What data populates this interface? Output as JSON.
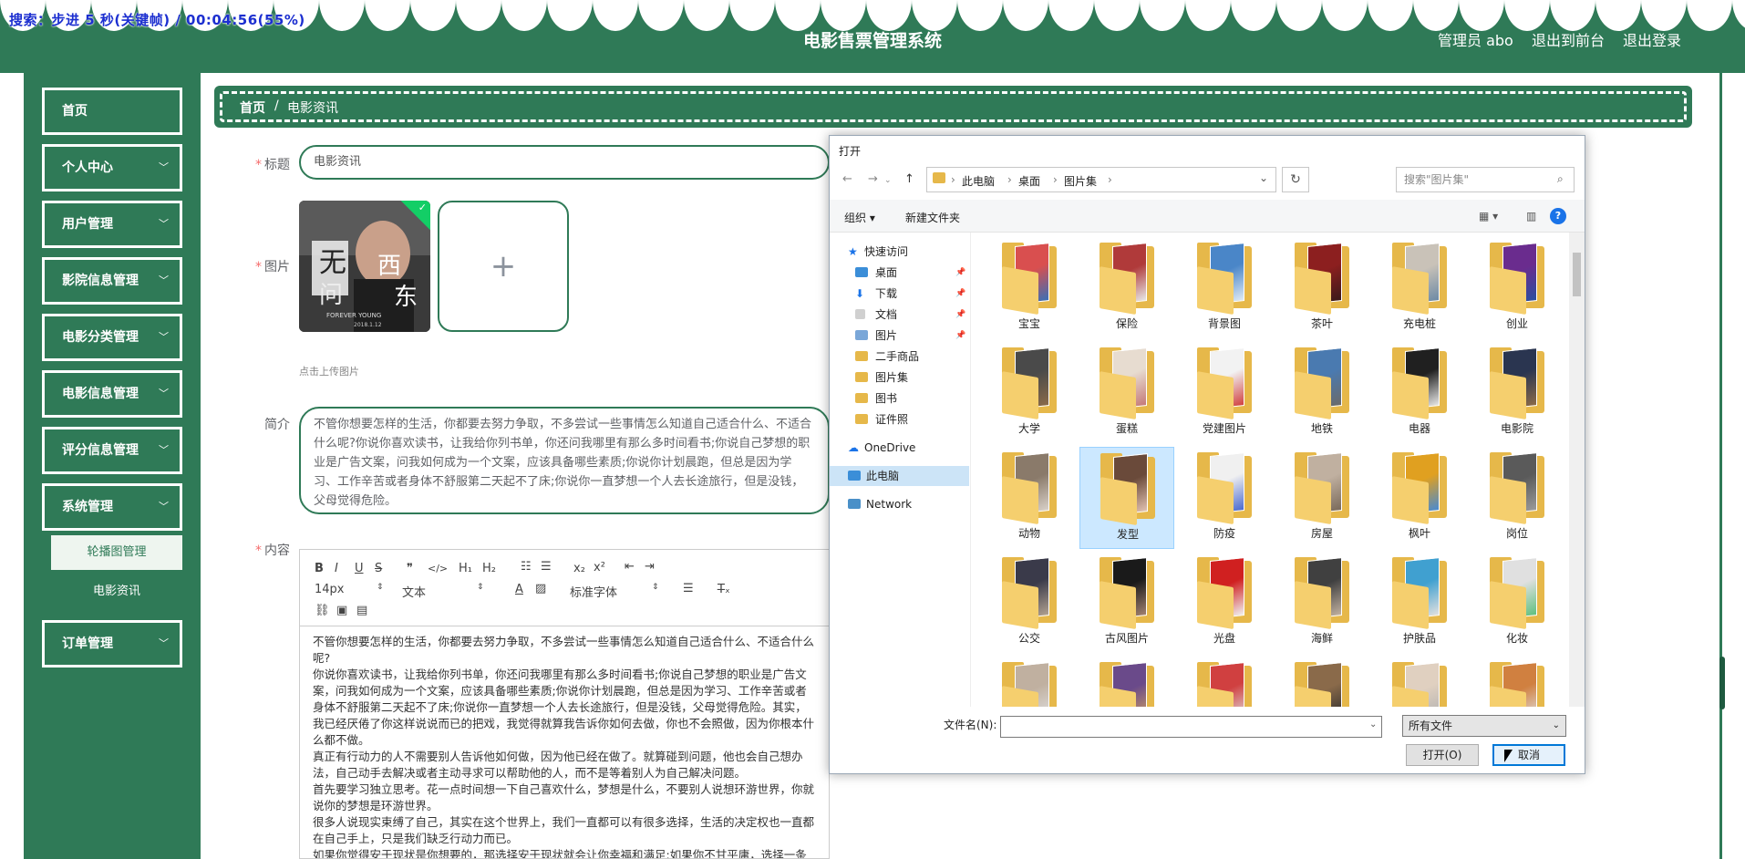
{
  "overlay_text": "搜索：步进 5 秒(关键帧) / 00:04:56(55%)",
  "header": {
    "title": "电影售票管理系统",
    "admin": "管理员 abo",
    "back_front": "退出到前台",
    "logout": "退出登录"
  },
  "sidebar": {
    "items": [
      {
        "label": "首页"
      },
      {
        "label": "个人中心"
      },
      {
        "label": "用户管理"
      },
      {
        "label": "影院信息管理"
      },
      {
        "label": "电影分类管理"
      },
      {
        "label": "电影信息管理"
      },
      {
        "label": "评分信息管理"
      },
      {
        "label": "系统管理"
      },
      {
        "label": "订单管理"
      }
    ],
    "sub_items": [
      {
        "label": "轮播图管理"
      },
      {
        "label": "电影资讯"
      }
    ]
  },
  "breadcrumb": {
    "home": "首页",
    "sep": "/",
    "current": "电影资讯"
  },
  "form": {
    "title_label": "标题",
    "title_value": "电影资讯",
    "image_label": "图片",
    "upload_tip": "点击上传图片",
    "plus": "+",
    "intro_label": "简介",
    "intro_value": "不管你想要怎样的生活，你都要去努力争取，不多尝试一些事情怎么知道自己适合什么、不适合什么呢?你说你喜欢读书，让我给你列书单，你还问我哪里有那么多时间看书;你说自己梦想的职业是广告文案，问我如何成为一个文案，应该具备哪些素质;你说你计划晨跑，但总是因为学习、工作辛苦或者身体不舒服第二天起不了床;你说你一直梦想一个人去长途旅行，但是没钱，父母觉得危险。",
    "content_label": "内容",
    "poster_text": {
      "a": "无",
      "b": "问",
      "c": "西",
      "d": "东",
      "e": "FOREVER YOUNG",
      "f": "2018.1.12"
    }
  },
  "editor": {
    "toolbar": {
      "font_size": "14px",
      "text_type": "文本",
      "font_family": "标准字体",
      "bold": "B",
      "italic": "I",
      "underline": "U",
      "strike": "S",
      "quote": "❞",
      "code": "</>",
      "h1": "H₁",
      "h2": "H₂",
      "sub": "x₂",
      "sup": "x²",
      "font_color": "A",
      "clear": "T̶ₓ"
    },
    "paragraphs": [
      "不管你想要怎样的生活，你都要去努力争取，不多尝试一些事情怎么知道自己适合什么、不适合什么呢?",
      "你说你喜欢读书，让我给你列书单，你还问我哪里有那么多时间看书;你说自己梦想的职业是广告文案，问我如何成为一个文案，应该具备哪些素质;你说你计划晨跑，但总是因为学习、工作辛苦或者身体不舒服第二天起不了床;你说你一直梦想一个人去长途旅行，但是没钱，父母觉得危险。其实，我已经厌倦了你这样说说而已的把戏，我觉得就算我告诉你如何去做，你也不会照做，因为你根本什么都不做。",
      "真正有行动力的人不需要别人告诉他如何做，因为他已经在做了。就算碰到问题，他也会自己想办法，自己动手去解决或者主动寻求可以帮助他的人，而不是等着别人为自己解决问题。",
      "首先要学习独立思考。花一点时间想一下自己喜欢什么，梦想是什么，不要别人说想环游世界，你就说你的梦想是环游世界。",
      "很多人说现实束缚了自己，其实在这个世界上，我们一直都可以有很多选择，生活的决定权也一直都在自己手上，只是我们缺乏行动力而已。",
      "如果你觉得安于现状是你想要的，那选择安于现状就会让你幸福和满足;如果你不甘平庸，选择一条改变的道路，你就会发现自己的人生正在慢慢变化。"
    ]
  },
  "dialog": {
    "title": "打开",
    "path": [
      "此电脑",
      "桌面",
      "图片集"
    ],
    "search_placeholder": "搜索\"图片集\"",
    "organize": "组织 ▾",
    "new_folder": "新建文件夹",
    "nav": {
      "quick_access": "快速访问",
      "items": [
        "桌面",
        "下载",
        "文档",
        "图片",
        "二手商品",
        "图片集",
        "图书",
        "证件照"
      ],
      "onedrive": "OneDrive",
      "this_pc": "此电脑",
      "network": "Network"
    },
    "folders": [
      "宝宝",
      "保险",
      "背景图",
      "茶叶",
      "充电桩",
      "创业",
      "大学",
      "蛋糕",
      "党建图片",
      "地铁",
      "电器",
      "电影院",
      "动物",
      "发型",
      "防疫",
      "房屋",
      "枫叶",
      "岗位",
      "公交",
      "古风图片",
      "光盘",
      "海鲜",
      "护肤品",
      "化妆",
      "",
      "",
      "",
      "",
      "",
      ""
    ],
    "filename_label": "文件名(N):",
    "filename_value": "",
    "filetype": "所有文件",
    "open_btn": "打开(O)",
    "cancel_btn": "取消"
  },
  "colors": {
    "brand": "#2f7a57",
    "white": "#ffffff",
    "required": "#f56c6c",
    "selected_tile": "#cce8ff",
    "folder": "#e6b84a"
  },
  "icons": [
    "chevron-down-icon",
    "plus-icon",
    "check-icon",
    "folder-icon",
    "search-icon",
    "refresh-icon",
    "back-arrow-icon",
    "forward-arrow-icon",
    "up-arrow-icon",
    "star-icon",
    "cloud-icon",
    "computer-icon",
    "network-icon",
    "help-icon",
    "view-icon",
    "pane-icon",
    "cursor-icon"
  ]
}
